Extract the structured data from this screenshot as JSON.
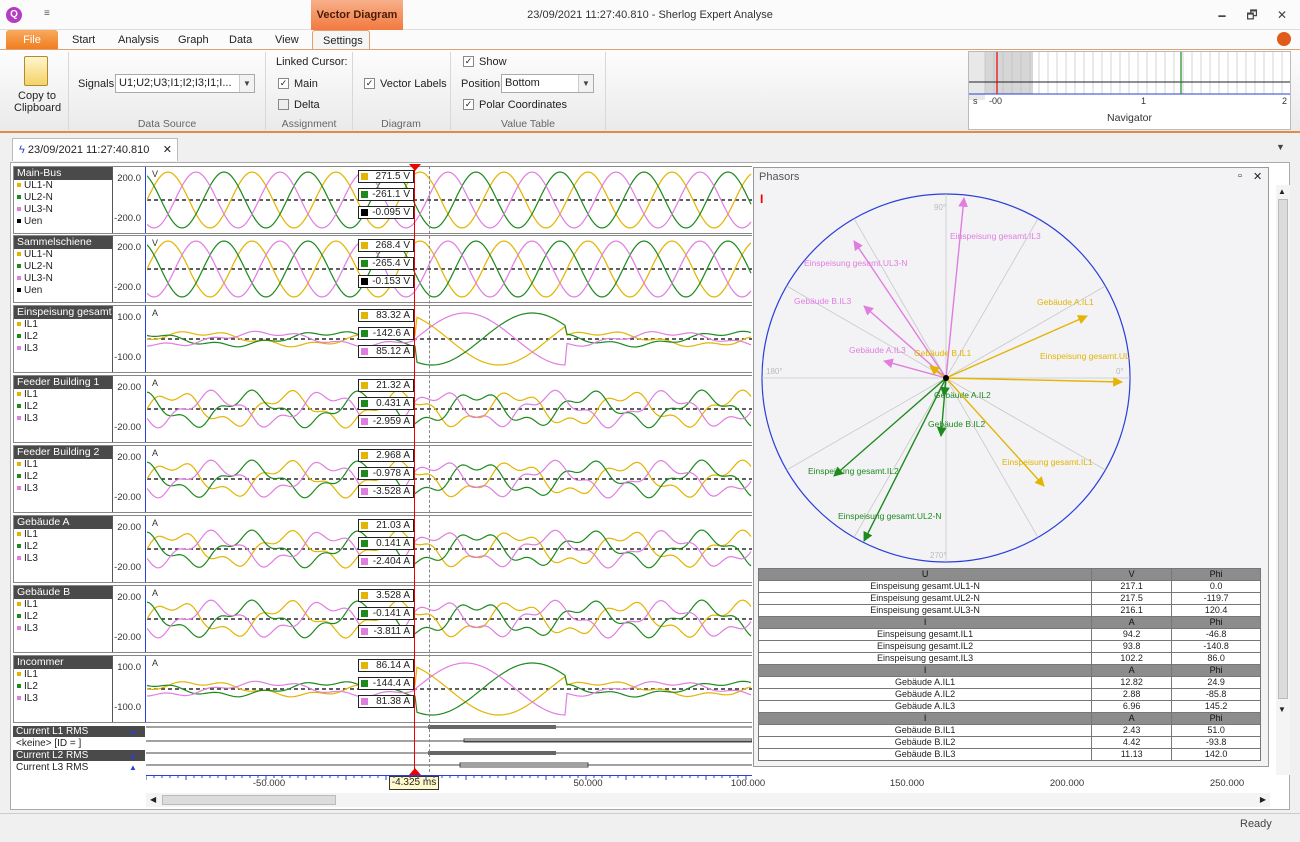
{
  "window": {
    "title": "23/09/2021 11:27:40.810 - Sherlog Expert Analyse",
    "contextual_tab": "Vector Diagram",
    "qat_glyph": "≡",
    "controls": {
      "minimize": "🗕",
      "maximize": "🗗",
      "close": "✕"
    }
  },
  "ribbon_tabs": [
    "File",
    "Start",
    "Analysis",
    "Graph",
    "Data",
    "View",
    "Settings"
  ],
  "ribbon": {
    "copy_label_1": "Copy to",
    "copy_label_2": "Clipboard",
    "signals_label": "Signals:",
    "signals_value": "U1;U2;U3;I1;I2;I3;I1;I...",
    "group_datasource": "Data Source",
    "linked_cursor_label": "Linked Cursor:",
    "main_label": "Main",
    "main_checked": "✓",
    "delta_label": "Delta",
    "delta_checked": "",
    "group_assignment": "Assignment",
    "vector_labels_label": "Vector Labels",
    "vector_labels_checked": "✓",
    "group_diagram": "Diagram",
    "show_label": "Show",
    "show_checked": "✓",
    "position_label": "Position:",
    "position_value": "Bottom",
    "polar_label": "Polar Coordinates",
    "polar_checked": "✓",
    "group_valuetable": "Value Table",
    "group_navigator": "Navigator",
    "nav_s": "s",
    "nav_ticks": [
      "-00",
      "1",
      "2"
    ]
  },
  "document_tab": "23/09/2021 11:27:40.810",
  "signals": [
    {
      "title": "Main-Bus",
      "items": [
        {
          "label": "UL1-N",
          "color": "#e3b400"
        },
        {
          "label": "UL2-N",
          "color": "#1d8a1d"
        },
        {
          "label": "UL3-N",
          "color": "#e07ee0"
        },
        {
          "label": "Uen",
          "color": "#000000"
        }
      ],
      "unit": "V",
      "ymax": "200.0",
      "ymin": "-200.0",
      "values": [
        {
          "text": "271.5 V",
          "color": "#e3b400"
        },
        {
          "text": "-261.1 V",
          "color": "#1d8a1d"
        },
        {
          "text": "-0.095 V",
          "color": "#000000"
        }
      ]
    },
    {
      "title": "Sammelschiene",
      "items": [
        {
          "label": "UL1-N",
          "color": "#e3b400"
        },
        {
          "label": "UL2-N",
          "color": "#1d8a1d"
        },
        {
          "label": "UL3-N",
          "color": "#e07ee0"
        },
        {
          "label": "Uen",
          "color": "#000000"
        }
      ],
      "unit": "V",
      "ymax": "200.0",
      "ymin": "-200.0",
      "values": [
        {
          "text": "268.4 V",
          "color": "#e3b400"
        },
        {
          "text": "-265.4 V",
          "color": "#1d8a1d"
        },
        {
          "text": "-0.153 V",
          "color": "#000000"
        }
      ]
    },
    {
      "title": "Einspeisung gesamt",
      "items": [
        {
          "label": "IL1",
          "color": "#e3b400"
        },
        {
          "label": "IL2",
          "color": "#1d8a1d"
        },
        {
          "label": "IL3",
          "color": "#e07ee0"
        }
      ],
      "unit": "A",
      "ymax": "100.0",
      "ymin": "-100.0",
      "values": [
        {
          "text": "83.32 A",
          "color": "#e3b400"
        },
        {
          "text": "-142.6 A",
          "color": "#1d8a1d"
        },
        {
          "text": "85.12 A",
          "color": "#e07ee0"
        }
      ]
    },
    {
      "title": "Feeder Building 1",
      "items": [
        {
          "label": "IL1",
          "color": "#e3b400"
        },
        {
          "label": "IL2",
          "color": "#1d8a1d"
        },
        {
          "label": "IL3",
          "color": "#e07ee0"
        }
      ],
      "unit": "A",
      "ymax": "20.00",
      "ymin": "-20.00",
      "values": [
        {
          "text": "21.32 A",
          "color": "#e3b400"
        },
        {
          "text": "0.431 A",
          "color": "#1d8a1d"
        },
        {
          "text": "-2.959 A",
          "color": "#e07ee0"
        }
      ]
    },
    {
      "title": "Feeder Building 2",
      "items": [
        {
          "label": "IL1",
          "color": "#e3b400"
        },
        {
          "label": "IL2",
          "color": "#1d8a1d"
        },
        {
          "label": "IL3",
          "color": "#e07ee0"
        }
      ],
      "unit": "A",
      "ymax": "20.00",
      "ymin": "-20.00",
      "values": [
        {
          "text": "2.968 A",
          "color": "#e3b400"
        },
        {
          "text": "-0.978 A",
          "color": "#1d8a1d"
        },
        {
          "text": "-3.528 A",
          "color": "#e07ee0"
        }
      ]
    },
    {
      "title": "Gebäude A",
      "items": [
        {
          "label": "IL1",
          "color": "#e3b400"
        },
        {
          "label": "IL2",
          "color": "#1d8a1d"
        },
        {
          "label": "IL3",
          "color": "#e07ee0"
        }
      ],
      "unit": "A",
      "ymax": "20.00",
      "ymin": "-20.00",
      "values": [
        {
          "text": "21.03 A",
          "color": "#e3b400"
        },
        {
          "text": "0.141 A",
          "color": "#1d8a1d"
        },
        {
          "text": "-2.404 A",
          "color": "#e07ee0"
        }
      ]
    },
    {
      "title": "Gebäude B",
      "items": [
        {
          "label": "IL1",
          "color": "#e3b400"
        },
        {
          "label": "IL2",
          "color": "#1d8a1d"
        },
        {
          "label": "IL3",
          "color": "#e07ee0"
        }
      ],
      "unit": "A",
      "ymax": "20.00",
      "ymin": "-20.00",
      "values": [
        {
          "text": "3.528 A",
          "color": "#e3b400"
        },
        {
          "text": "-0.141 A",
          "color": "#1d8a1d"
        },
        {
          "text": "-3.811 A",
          "color": "#e07ee0"
        }
      ]
    },
    {
      "title": "Incommer",
      "items": [
        {
          "label": "IL1",
          "color": "#e3b400"
        },
        {
          "label": "IL2",
          "color": "#1d8a1d"
        },
        {
          "label": "IL3",
          "color": "#e07ee0"
        }
      ],
      "unit": "A",
      "ymax": "100.0",
      "ymin": "-100.0",
      "values": [
        {
          "text": "86.14 A",
          "color": "#e3b400"
        },
        {
          "text": "-144.4 A",
          "color": "#1d8a1d"
        },
        {
          "text": "81.38 A",
          "color": "#e07ee0"
        }
      ]
    }
  ],
  "digital": [
    "Current L1 RMS",
    "<keine>  [ID = ]",
    "Current L2 RMS",
    "Current L3 RMS"
  ],
  "time_axis": {
    "ticks": [
      "-50.000",
      "50.000",
      "100.000",
      "150.000",
      "200.000",
      "250.000"
    ],
    "cursor": "-4.325 ms"
  },
  "phasors": {
    "title": "Phasors",
    "angles": {
      "top": "90°",
      "left": "180°",
      "right": "0°",
      "bottom": "270°"
    },
    "vectors": [
      {
        "label": "Einspeisung gesamt.IL3",
        "color": "#e07ee0"
      },
      {
        "label": "Einspeisung gesamt.UL3-N",
        "color": "#e07ee0"
      },
      {
        "label": "Gebäude B.IL3",
        "color": "#e07ee0"
      },
      {
        "label": "Gebäude A.IL3",
        "color": "#e07ee0"
      },
      {
        "label": "Gebäude B.IL1",
        "color": "#e3b400"
      },
      {
        "label": "Gebäude A.IL1",
        "color": "#e3b400"
      },
      {
        "label": "Einspeisung gesamt.UL",
        "color": "#e3b400"
      },
      {
        "label": "Gebäude A.IL2",
        "color": "#1d8a1d"
      },
      {
        "label": "Gebäude B.IL2",
        "color": "#1d8a1d"
      },
      {
        "label": "Einspeisung gesamt.IL1",
        "color": "#e3b400"
      },
      {
        "label": "Einspeisung gesamt.IL2",
        "color": "#1d8a1d"
      },
      {
        "label": "Einspeisung gesamt.UL2-N",
        "color": "#1d8a1d"
      }
    ],
    "table": [
      {
        "header": [
          "U",
          "V",
          "Phi"
        ],
        "rows": [
          [
            "Einspeisung gesamt.UL1-N",
            "217.1",
            "0.0"
          ],
          [
            "Einspeisung gesamt.UL2-N",
            "217.5",
            "-119.7"
          ],
          [
            "Einspeisung gesamt.UL3-N",
            "216.1",
            "120.4"
          ]
        ]
      },
      {
        "header": [
          "I",
          "A",
          "Phi"
        ],
        "rows": [
          [
            "Einspeisung gesamt.IL1",
            "94.2",
            "-46.8"
          ],
          [
            "Einspeisung gesamt.IL2",
            "93.8",
            "-140.8"
          ],
          [
            "Einspeisung gesamt.IL3",
            "102.2",
            "86.0"
          ]
        ]
      },
      {
        "header": [
          "I",
          "A",
          "Phi"
        ],
        "rows": [
          [
            "Gebäude A.IL1",
            "12.82",
            "24.9"
          ],
          [
            "Gebäude A.IL2",
            "2.88",
            "-85.8"
          ],
          [
            "Gebäude A.IL3",
            "6.96",
            "145.2"
          ]
        ]
      },
      {
        "header": [
          "I",
          "A",
          "Phi"
        ],
        "rows": [
          [
            "Gebäude B.IL1",
            "2.43",
            "51.0"
          ],
          [
            "Gebäude B.IL2",
            "4.42",
            "-93.8"
          ],
          [
            "Gebäude B.IL3",
            "11.13",
            "142.0"
          ]
        ]
      }
    ]
  },
  "status": "Ready"
}
